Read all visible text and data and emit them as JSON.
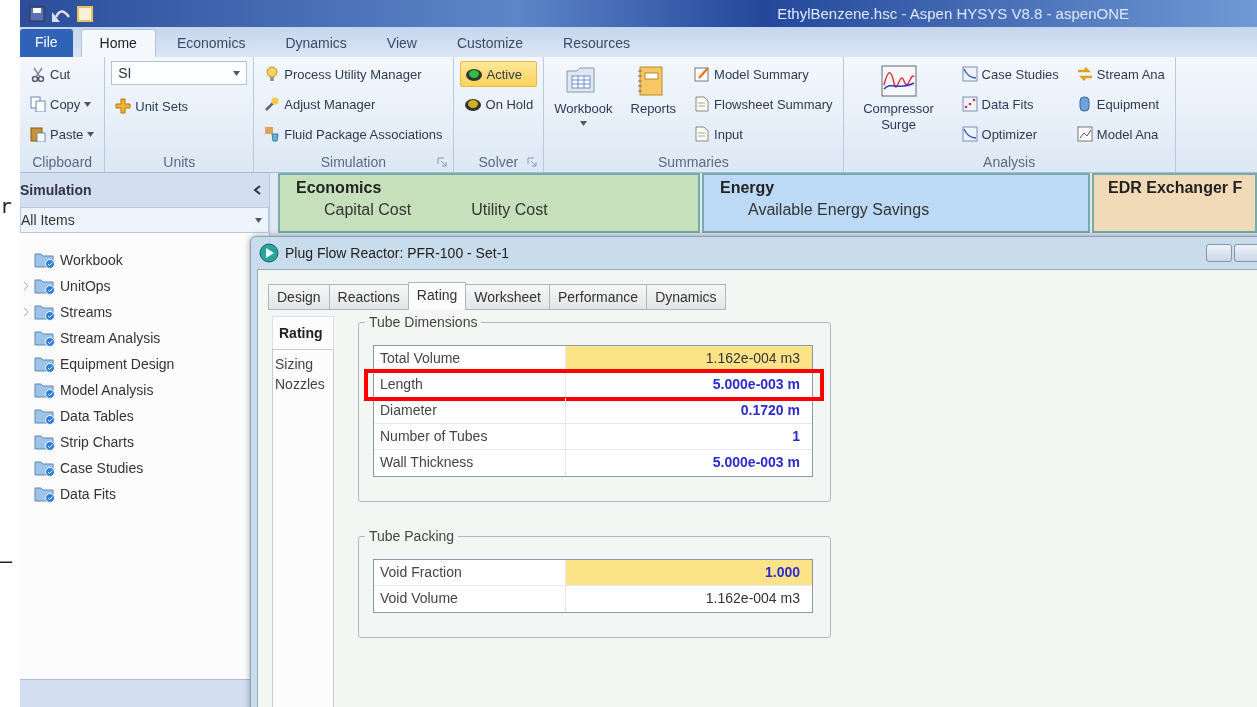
{
  "title_bar": {
    "title": "EthylBenzene.hsc - Aspen HYSYS V8.8 - aspenONE"
  },
  "left_margin": {
    "text_1": "r",
    "text_2": "–"
  },
  "ribbon_tabs": [
    {
      "label": "File",
      "kind": "file",
      "selected": false
    },
    {
      "label": "Home",
      "kind": "tab",
      "selected": true
    },
    {
      "label": "Economics",
      "kind": "tab",
      "selected": false
    },
    {
      "label": "Dynamics",
      "kind": "tab",
      "selected": false
    },
    {
      "label": "View",
      "kind": "tab",
      "selected": false
    },
    {
      "label": "Customize",
      "kind": "tab",
      "selected": false
    },
    {
      "label": "Resources",
      "kind": "tab",
      "selected": false
    }
  ],
  "ribbon_groups": [
    {
      "label": "Clipboard",
      "launcher": false,
      "columns": [
        [
          {
            "kind": "small",
            "label": "Cut",
            "dropdown": false
          },
          {
            "kind": "small",
            "label": "Copy",
            "dropdown": true
          },
          {
            "kind": "small",
            "label": "Paste",
            "dropdown": true
          }
        ]
      ]
    },
    {
      "label": "Units",
      "launcher": false,
      "columns": [
        [
          {
            "kind": "combo",
            "value": "SI"
          },
          {
            "kind": "small",
            "label": "Unit Sets",
            "dropdown": false
          }
        ]
      ]
    },
    {
      "label": "Simulation",
      "launcher": true,
      "columns": [
        [
          {
            "kind": "small",
            "label": "Process Utility Manager",
            "dropdown": false
          },
          {
            "kind": "small",
            "label": "Adjust Manager",
            "dropdown": false
          },
          {
            "kind": "small",
            "label": "Fluid Package Associations",
            "dropdown": false
          }
        ]
      ]
    },
    {
      "label": "Solver",
      "launcher": true,
      "columns": [
        [
          {
            "kind": "toggle",
            "label": "Active",
            "selected": true
          },
          {
            "kind": "toggle",
            "label": "On Hold",
            "selected": false
          }
        ]
      ]
    },
    {
      "label": "Summaries",
      "launcher": false,
      "columns": [
        [
          {
            "kind": "large",
            "label": "Workbook",
            "dropdown": true
          }
        ],
        [
          {
            "kind": "large",
            "label": "Reports",
            "dropdown": false
          }
        ],
        [
          {
            "kind": "small",
            "label": "Model Summary",
            "dropdown": false
          },
          {
            "kind": "small",
            "label": "Flowsheet Summary",
            "dropdown": false
          },
          {
            "kind": "small",
            "label": "Input",
            "dropdown": false
          }
        ]
      ]
    },
    {
      "label": "Analysis",
      "launcher": false,
      "columns": [
        [
          {
            "kind": "large",
            "label": "Compressor Surge",
            "dropdown": false
          }
        ],
        [
          {
            "kind": "small",
            "label": "Case Studies",
            "dropdown": false
          },
          {
            "kind": "small",
            "label": "Data Fits",
            "dropdown": false
          },
          {
            "kind": "small",
            "label": "Optimizer",
            "dropdown": false
          }
        ],
        [
          {
            "kind": "small",
            "label": "Stream Ana",
            "dropdown": false
          },
          {
            "kind": "small",
            "label": "Equipment",
            "dropdown": false
          },
          {
            "kind": "small",
            "label": "Model Ana",
            "dropdown": false
          }
        ]
      ]
    }
  ],
  "navigator": {
    "title": "Simulation",
    "filter": "All Items",
    "items": [
      {
        "label": "Workbook",
        "expandable": false
      },
      {
        "label": "UnitOps",
        "expandable": true
      },
      {
        "label": "Streams",
        "expandable": true
      },
      {
        "label": "Stream Analysis",
        "expandable": false
      },
      {
        "label": "Equipment Design",
        "expandable": false
      },
      {
        "label": "Model Analysis",
        "expandable": false
      },
      {
        "label": "Data Tables",
        "expandable": false
      },
      {
        "label": "Strip Charts",
        "expandable": false
      },
      {
        "label": "Case Studies",
        "expandable": false
      },
      {
        "label": "Data Fits",
        "expandable": false
      }
    ]
  },
  "dashboard": [
    {
      "title": "Economics",
      "color": "#c6e0bb",
      "items": [
        "Capital Cost",
        "Utility Cost"
      ]
    },
    {
      "title": "Energy",
      "color": "#bcdaf5",
      "items": [
        "Available Energy Savings"
      ]
    },
    {
      "title": "EDR Exchanger F",
      "color": "#f0dab8"
    }
  ],
  "dialog": {
    "title": "Plug Flow Reactor: PFR-100 - Set-1",
    "tabs": [
      {
        "label": "Design",
        "selected": false
      },
      {
        "label": "Reactions",
        "selected": false
      },
      {
        "label": "Rating",
        "selected": true
      },
      {
        "label": "Worksheet",
        "selected": false
      },
      {
        "label": "Performance",
        "selected": false
      },
      {
        "label": "Dynamics",
        "selected": false
      }
    ],
    "side_nav": [
      {
        "label": "Rating",
        "selected": true
      },
      {
        "label": "Sizing",
        "selected": false
      },
      {
        "label": "Nozzles",
        "selected": false
      }
    ],
    "groups": [
      {
        "title": "Tube Dimensions",
        "rows": [
          {
            "label": "Total Volume",
            "value": "1.162e-004 m3",
            "highlighted": true,
            "specified": false,
            "outlined": false
          },
          {
            "label": "Length",
            "value": "5.000e-003 m",
            "highlighted": false,
            "specified": true,
            "outlined": true
          },
          {
            "label": "Diameter",
            "value": "0.1720 m",
            "highlighted": false,
            "specified": true,
            "outlined": false
          },
          {
            "label": "Number of Tubes",
            "value": "1",
            "highlighted": false,
            "specified": true,
            "outlined": false
          },
          {
            "label": "Wall Thickness",
            "value": "5.000e-003 m",
            "highlighted": false,
            "specified": true,
            "outlined": false
          }
        ]
      },
      {
        "title": "Tube Packing",
        "rows": [
          {
            "label": "Void Fraction",
            "value": "1.000",
            "highlighted": true,
            "specified": true,
            "outlined": false
          },
          {
            "label": "Void Volume",
            "value": "1.162e-004 m3",
            "highlighted": false,
            "specified": false,
            "outlined": false
          }
        ]
      }
    ]
  }
}
